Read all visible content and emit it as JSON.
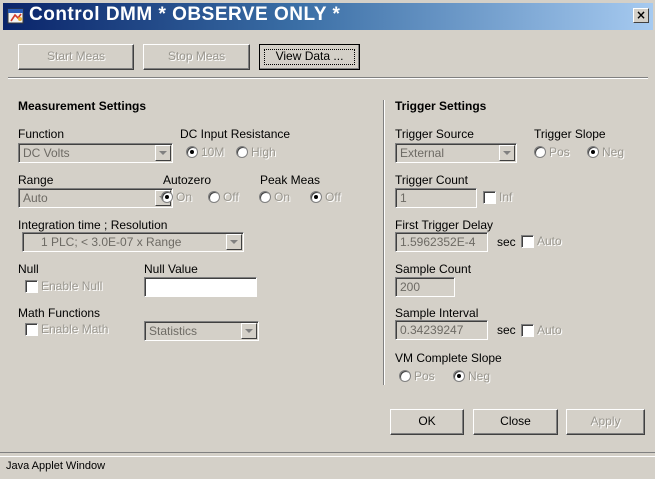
{
  "window": {
    "title": "Control DMM * OBSERVE ONLY *",
    "close_glyph": "×",
    "app_icon": "java-applet-icon",
    "status": "Java Applet Window"
  },
  "toolbar": {
    "start_label": "Start Meas",
    "stop_label": "Stop Meas",
    "view_label": "View Data ..."
  },
  "measurement": {
    "title": "Measurement Settings",
    "function_label": "Function",
    "function_value": "DC Volts",
    "dc_input_label": "DC Input Resistance",
    "dc_input_opt1": "10M",
    "dc_input_opt2": "High",
    "dc_input_selected": "10M",
    "range_label": "Range",
    "range_value": "Auto",
    "autozero_label": "Autozero",
    "autozero_on": "On",
    "autozero_off": "Off",
    "autozero_selected": "On",
    "peak_label": "Peak Meas",
    "peak_on": "On",
    "peak_off": "Off",
    "peak_selected": "Off",
    "integration_label": "Integration time ; Resolution",
    "integration_value": "1 PLC; < 3.0E-07 x Range",
    "null_label": "Null",
    "null_enable": "Enable Null",
    "null_value_label": "Null Value",
    "null_value": "",
    "math_label": "Math Functions",
    "math_enable": "Enable Math",
    "math_function": "Statistics"
  },
  "trigger": {
    "title": "Trigger Settings",
    "source_label": "Trigger Source",
    "source_value": "External",
    "slope_label": "Trigger Slope",
    "slope_pos": "Pos",
    "slope_neg": "Neg",
    "slope_selected": "Neg",
    "count_label": "Trigger Count",
    "count_value": "1",
    "count_inf": "Inf",
    "delay_label": "First Trigger Delay",
    "delay_value": "1.5962352E-4",
    "delay_unit": "sec",
    "delay_auto": "Auto",
    "sample_count_label": "Sample Count",
    "sample_count_value": "200",
    "sample_interval_label": "Sample Interval",
    "sample_interval_value": "0.34239247",
    "sample_interval_unit": "sec",
    "sample_interval_auto": "Auto",
    "vm_label": "VM Complete Slope",
    "vm_pos": "Pos",
    "vm_neg": "Neg",
    "vm_selected": "Neg"
  },
  "footer": {
    "ok": "OK",
    "close": "Close",
    "apply": "Apply"
  }
}
